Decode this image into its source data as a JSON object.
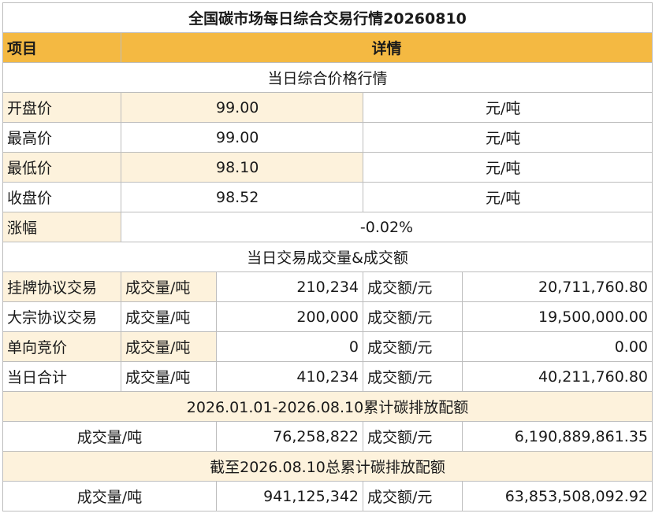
{
  "title": "全国碳市场每日综合交易行情20260810",
  "header": {
    "item": "项目",
    "detail": "详情"
  },
  "section_price": "当日综合价格行情",
  "prices": [
    {
      "label": "开盘价",
      "value": "99.00",
      "unit": "元/吨"
    },
    {
      "label": "最高价",
      "value": "99.00",
      "unit": "元/吨"
    },
    {
      "label": "最低价",
      "value": "98.10",
      "unit": "元/吨"
    },
    {
      "label": "收盘价",
      "value": "98.52",
      "unit": "元/吨"
    }
  ],
  "change": {
    "label": "涨幅",
    "value": "-0.02%"
  },
  "section_volume": "当日交易成交量&成交额",
  "volume_rows": [
    {
      "label": "挂牌协议交易",
      "vol_label": "成交量/吨",
      "vol": "210,234",
      "amt_label": "成交额/元",
      "amt": "20,711,760.80"
    },
    {
      "label": "大宗协议交易",
      "vol_label": "成交量/吨",
      "vol": "200,000",
      "amt_label": "成交额/元",
      "amt": "19,500,000.00"
    },
    {
      "label": "单向竞价",
      "vol_label": "成交量/吨",
      "vol": "0",
      "amt_label": "成交额/元",
      "amt": "0.00"
    },
    {
      "label": "当日合计",
      "vol_label": "成交量/吨",
      "vol": "410,234",
      "amt_label": "成交额/元",
      "amt": "40,211,760.80"
    }
  ],
  "ytd": {
    "heading": "2026.01.01-2026.08.10累计碳排放配额",
    "vol_label": "成交量/吨",
    "vol": "76,258,822",
    "amt_label": "成交额/元",
    "amt": "6,190,889,861.35"
  },
  "total": {
    "heading": "截至2026.08.10总累计碳排放配额",
    "vol_label": "成交量/吨",
    "vol": "941,125,342",
    "amt_label": "成交额/元",
    "amt": "63,853,508,092.92"
  },
  "colors": {
    "header_orange": "#f4b942",
    "cream": "#fdf2dc",
    "grid": "#bdbdbd"
  }
}
